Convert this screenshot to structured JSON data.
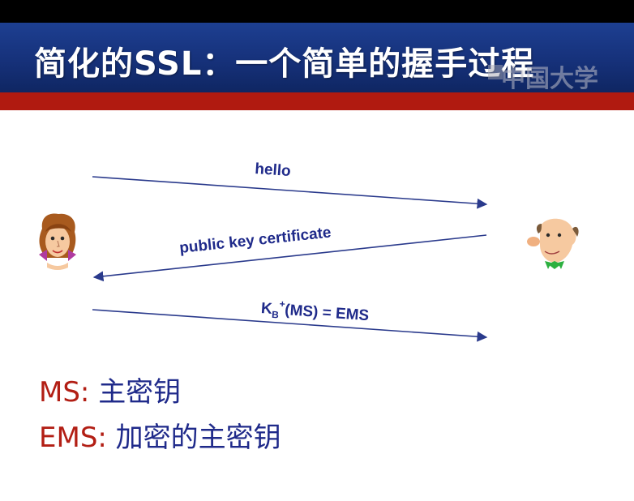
{
  "slide": {
    "title": "简化的SSL：一个简单的握手过程",
    "watermark": "中国大学"
  },
  "diagram": {
    "messages": [
      {
        "label": "hello",
        "direction": "to-right"
      },
      {
        "label": "public key certificate",
        "direction": "to-left"
      },
      {
        "label_main": "K",
        "label_sub": "B",
        "label_sup": "+",
        "label_rest": "(MS) = EMS",
        "direction": "to-right"
      }
    ],
    "participants": [
      "alice-icon",
      "bob-icon"
    ]
  },
  "legend": [
    {
      "key": "MS:",
      "value": "主密钥"
    },
    {
      "key": "EMS:",
      "value": "加密的主密钥"
    }
  ],
  "colors": {
    "title_bg": "#16317a",
    "accent_red": "#b01a10",
    "arrow": "#2a3a8c",
    "label_text": "#1f2a8a",
    "legend_key": "#b21e14"
  }
}
